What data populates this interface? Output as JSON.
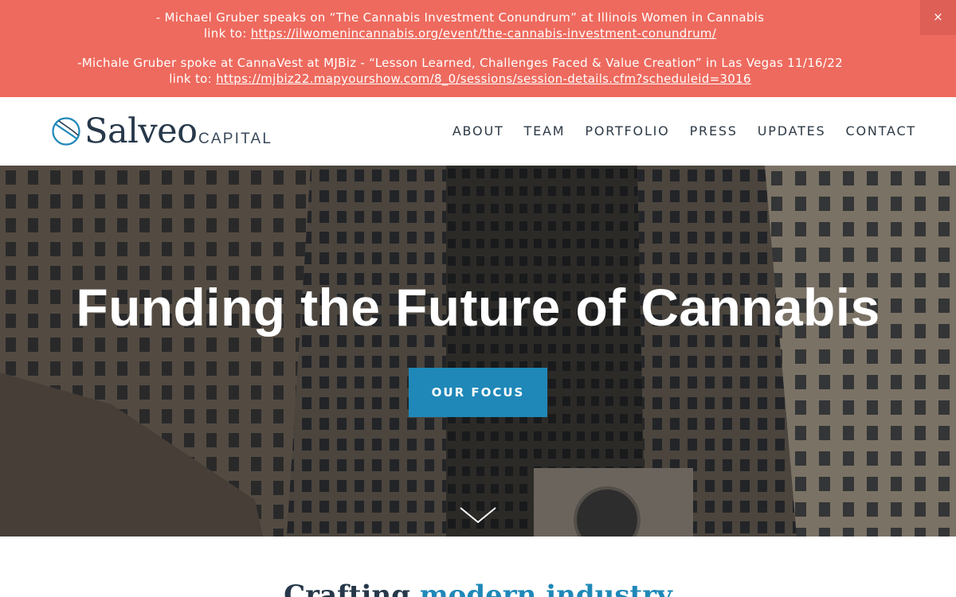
{
  "banner": {
    "line1": "- Michael Gruber speaks on “The Cannabis Investment Conundrum” at Illinois Women in Cannabis",
    "line1_link_prefix": "link to: ",
    "line1_link": "https://ilwomenincannabis.org/event/the-cannabis-investment-conundrum/",
    "line2": "-Michale Gruber spoke at CannaVest at MJBiz - “Lesson Learned, Challenges Faced & Value Creation” in Las Vegas 11/16/22",
    "line2_link_prefix": "link to: ",
    "line2_link": "https://mjbiz22.mapyourshow.com/8_0/sessions/session-details.cfm?scheduleid=3016",
    "close": "×",
    "color": "#ee6a5e"
  },
  "logo": {
    "word": "Salveo",
    "sub": "CAPITAL"
  },
  "nav": {
    "items": [
      "ABOUT",
      "TEAM",
      "PORTFOLIO",
      "PRESS",
      "UPDATES",
      "CONTACT"
    ]
  },
  "hero": {
    "title": "Funding the Future of Cannabis",
    "button": "OUR FOCUS",
    "button_color": "#1f88b8"
  },
  "next_section": {
    "heading_start": "Crafting ",
    "heading_accent": "modern industry"
  }
}
